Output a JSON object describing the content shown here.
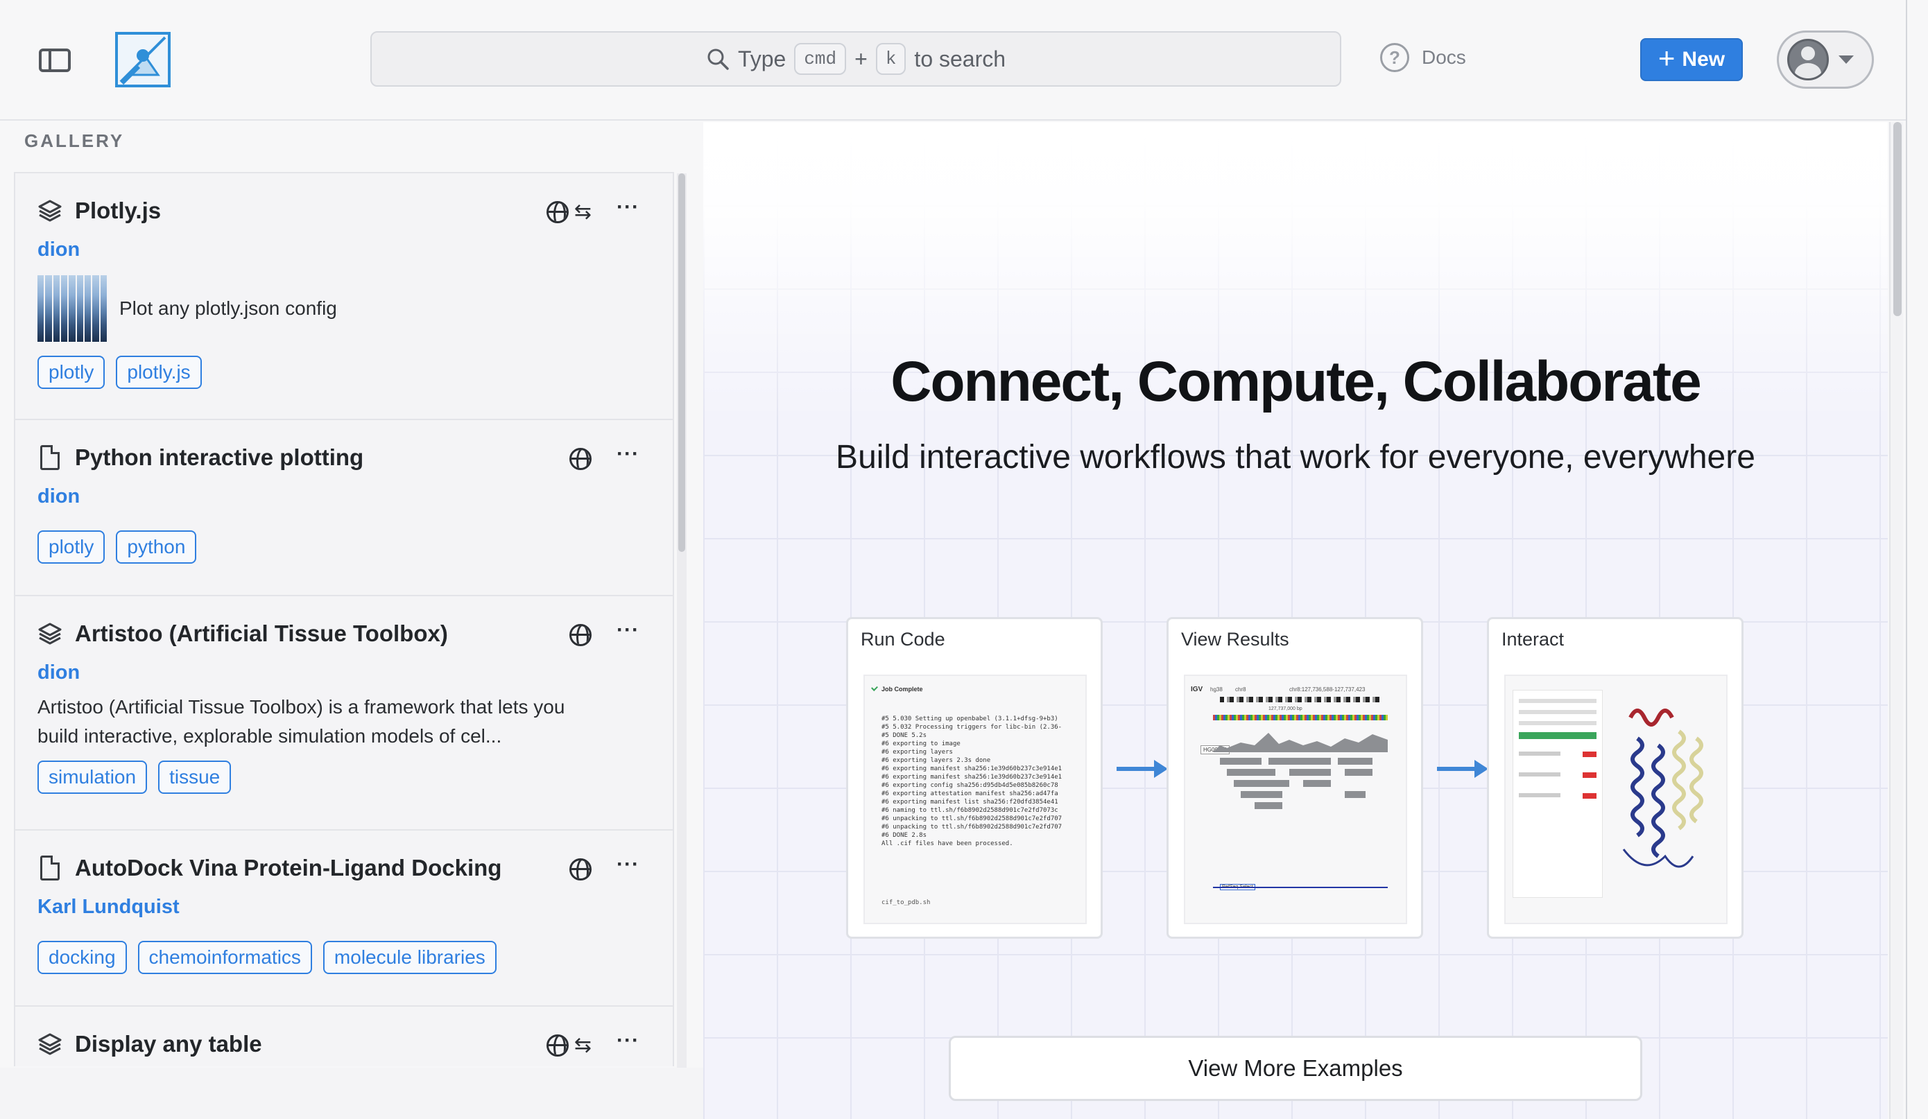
{
  "header": {
    "search": {
      "type_label": "Type",
      "key1": "cmd",
      "plus": "+",
      "key2": "k",
      "suffix": "to search"
    },
    "docs_label": "Docs",
    "new_label": "New"
  },
  "sidebar": {
    "section_label": "GALLERY",
    "cards": [
      {
        "title": "Plotly.js",
        "author": "dion",
        "description": "Plot any plotly.json config",
        "tags": [
          "plotly",
          "plotly.js"
        ],
        "icon": "layers-icon",
        "public": true,
        "shared": true
      },
      {
        "title": "Python interactive plotting",
        "author": "dion",
        "description": "",
        "tags": [
          "plotly",
          "python"
        ],
        "icon": "document-icon",
        "public": true,
        "shared": false
      },
      {
        "title": "Artistoo (Artificial Tissue Toolbox)",
        "author": "dion",
        "description": "Artistoo (Artificial Tissue Toolbox) is a framework that lets you build interactive, explorable simulation models of cel...",
        "tags": [
          "simulation",
          "tissue"
        ],
        "icon": "layers-icon",
        "public": true,
        "shared": false
      },
      {
        "title": "AutoDock Vina Protein-Ligand Docking",
        "author": "Karl Lundquist",
        "description": "",
        "tags": [
          "docking",
          "chemoinformatics",
          "molecule libraries"
        ],
        "icon": "document-icon",
        "public": true,
        "shared": false
      },
      {
        "title": "Display any table",
        "icon": "layers-icon",
        "public": true,
        "shared": true
      }
    ]
  },
  "main": {
    "hero_title": "Connect, Compute, Collaborate",
    "hero_subtitle": "Build interactive workflows that work for everyone, everywhere",
    "steps": [
      {
        "label": "Run Code"
      },
      {
        "label": "View Results"
      },
      {
        "label": "Interact"
      }
    ],
    "view_more_label": "View More Examples",
    "code_preview": {
      "status": "Job Complete",
      "filename": "cif_to_pdb.sh",
      "lines": [
        "#5 5.030 Setting up openbabel (3.1.1+dfsg-9+b3)",
        "#5 5.032 Processing triggers for libc-bin (2.36-",
        "#5 DONE 5.2s",
        "#6 exporting to image",
        "#6 exporting layers",
        "#6 exporting layers 2.3s done",
        "#6 exporting manifest sha256:1e39d60b237c3e914e1",
        "#6 exporting manifest sha256:1e39d60b237c3e914e1",
        "#6 exporting config sha256:d95db4d5e085b8260c78",
        "#6 exporting attestation manifest sha256:ad47fa",
        "#6 exporting manifest list sha256:f20dfd3854e41",
        "#6 naming to ttl.sh/f6b8902d2588d901c7e2fd7073c",
        "#6 unpacking to ttl.sh/f6b8902d2588d901c7e2fd707",
        "#6 unpacking to ttl.sh/f6b8902d2588d901c7e2fd707",
        "#6 DONE 2.8s",
        "All .cif files have been processed."
      ]
    },
    "igv_preview": {
      "brand": "IGV",
      "genome": "hg38",
      "chrom": "chr8",
      "locus": "chr8:127,736,588-127,737,423",
      "ruler": "127,737,000 bp",
      "gene": "HG00103",
      "track": "RefSeq Select"
    }
  },
  "colors": {
    "accent": "#2f7fe0",
    "arrow": "#3f86d6"
  }
}
